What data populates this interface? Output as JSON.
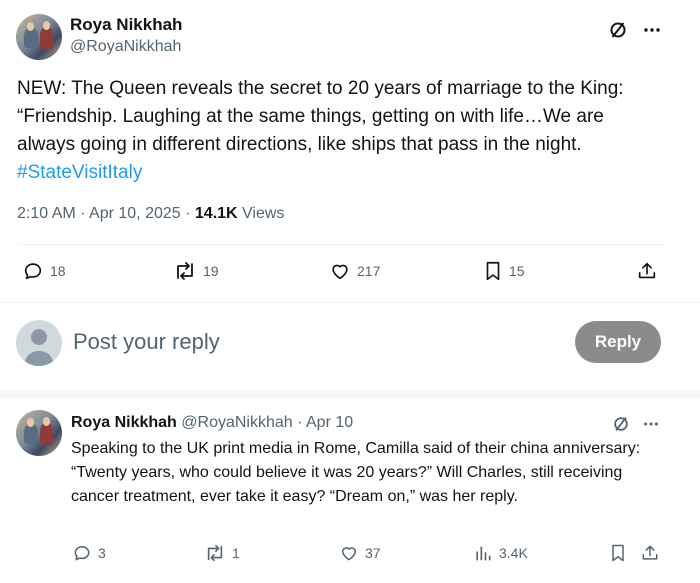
{
  "main_tweet": {
    "author_name": "Roya Nikkhah",
    "author_handle": "@RoyaNikkhah",
    "text": "NEW: The Queen reveals the secret to 20 years of marriage to the King: “Friendship. Laughing at the same things, getting on with life…We are always going in different directions, like ships that pass in the night.",
    "hashtag": "#StateVisitItaly",
    "time": "2:10 AM · Apr 10, 2025 · ",
    "views_count": "14.1K",
    "views_label": " Views",
    "stats": {
      "replies": "18",
      "reposts": "19",
      "likes": "217",
      "bookmarks": "15"
    }
  },
  "compose": {
    "placeholder": "Post your reply",
    "reply_button": "Reply"
  },
  "reply_tweet": {
    "author_name": "Roya Nikkhah",
    "author_handle": "@RoyaNikkhah",
    "date": " · Apr 10",
    "text": "Speaking to the UK print media in Rome, Camilla said of their china anniversary: “Twenty years, who could believe it was 20 years?” Will Charles, still receiving cancer treatment, ever take it easy? “Dream on,” was her reply.",
    "stats": {
      "replies": "3",
      "reposts": "1",
      "likes": "37",
      "views": "3.4K"
    }
  },
  "icons": {
    "grok": "grok-slash-circle-icon",
    "more": "more-dots-icon",
    "reply": "speech-bubble-icon",
    "repost": "repost-arrows-icon",
    "like": "heart-icon",
    "bookmark": "bookmark-icon",
    "share": "share-upload-icon",
    "views": "bar-chart-icon",
    "avatar_placeholder": "person-silhouette-icon"
  },
  "colors": {
    "text_primary": "#0f1419",
    "text_secondary": "#536471",
    "link": "#1d9bf0",
    "reply_button_bg": "#8b8b8b",
    "divider": "#eff3f4"
  }
}
